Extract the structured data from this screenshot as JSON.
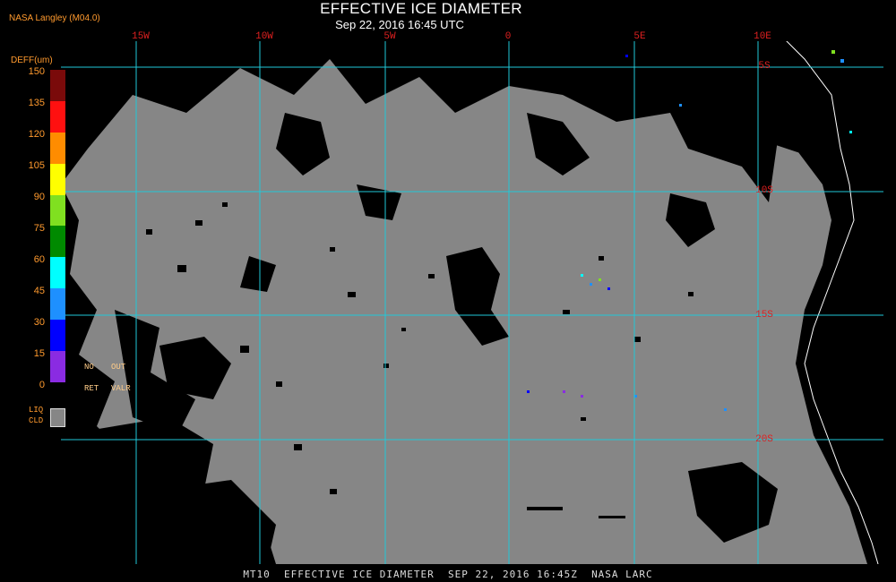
{
  "header": {
    "title": "EFFECTIVE ICE DIAMETER",
    "subtitle": "Sep 22, 2016 16:45 UTC",
    "producer": "NASA Langley (M04.0)"
  },
  "map": {
    "longitude_labels": [
      "15W",
      "10W",
      "5W",
      "0",
      "5E",
      "10E"
    ],
    "latitude_labels": [
      "5S",
      "10S",
      "15S",
      "20S"
    ],
    "gridline_color": "#20c8d8",
    "clear_color": "#000000",
    "cloud_color": "#868686",
    "coastline_color": "#ffffff"
  },
  "legend": {
    "title": "DEFF(um)",
    "tick_labels": [
      "150",
      "135",
      "120",
      "105",
      "90",
      "75",
      "60",
      "45",
      "30",
      "15",
      "0"
    ],
    "colors": [
      "#7a0a0a",
      "#ff1010",
      "#ff8c00",
      "#ffff00",
      "#80e020",
      "#008a00",
      "#00ffff",
      "#1e90ff",
      "#0000ff",
      "#8a2be2"
    ],
    "no_ret_label": {
      "line1": "NO",
      "line2": "RET"
    },
    "out_valr_label": {
      "line1": "OUT",
      "line2": "VALR"
    },
    "liq_cld_label": {
      "line1": "LIQ",
      "line2": "CLD"
    },
    "liq_cld_color": "#868686"
  },
  "footer": {
    "text": "MT10  EFFECTIVE ICE DIAMETER  SEP 22, 2016 16:45Z  NASA LARC"
  }
}
